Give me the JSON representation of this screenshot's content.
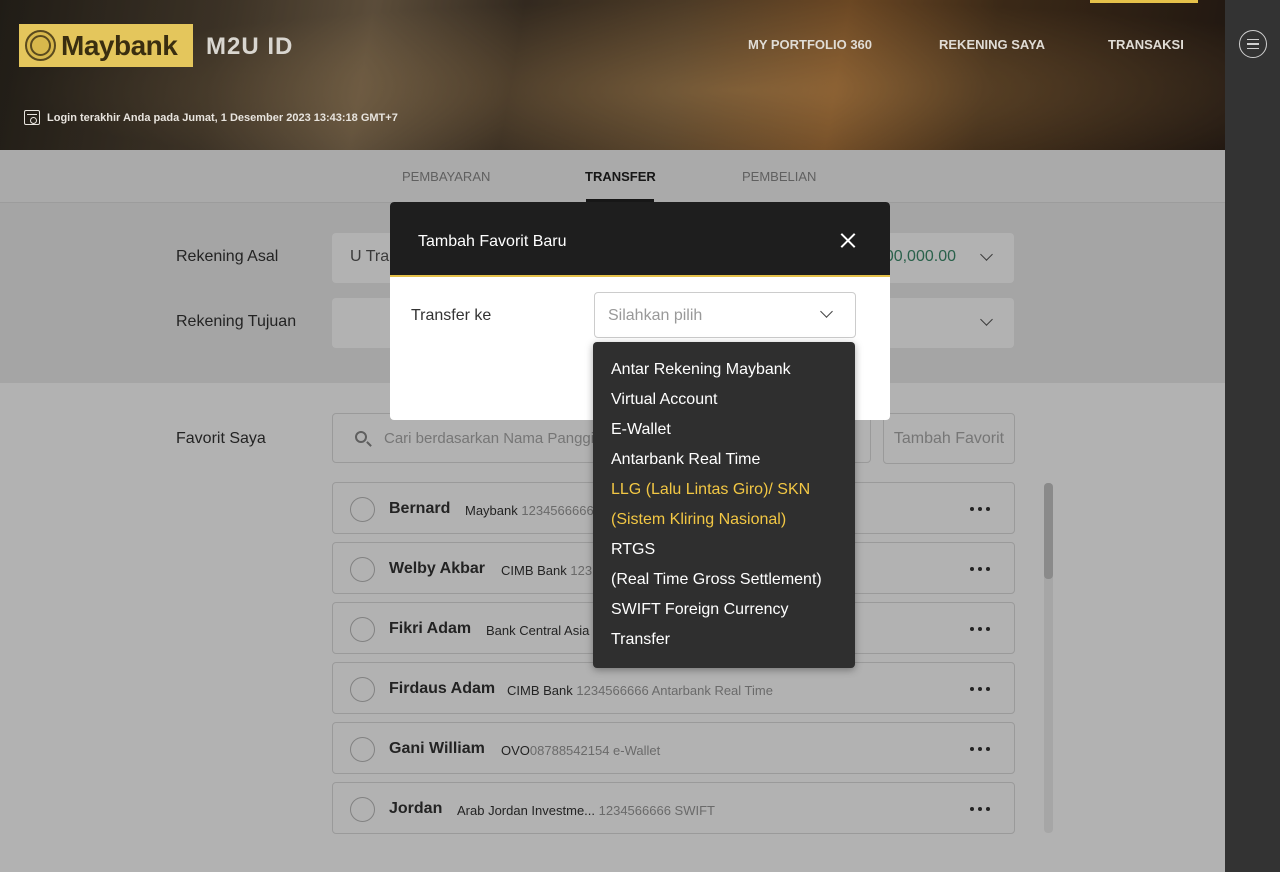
{
  "header": {
    "brand": "Maybank",
    "product": "M2U ID",
    "nav": [
      "MY PORTFOLIO 360",
      "REKENING SAYA",
      "TRANSAKSI"
    ],
    "last_login": "Login terakhir Anda pada Jumat, 1 Desember 2023 13:43:18 GMT+7"
  },
  "tabs": [
    "PEMBAYARAN",
    "TRANSFER",
    "PEMBELIAN"
  ],
  "active_tab": "TRANSFER",
  "form": {
    "source_label": "Rekening Asal",
    "source_value": "U Tra",
    "source_amount": "00,000.00",
    "dest_label": "Rekening Tujuan"
  },
  "favorites": {
    "label": "Favorit Saya",
    "search_placeholder": "Cari berdasarkan Nama Panggilan,",
    "add_button": "Tambah Favorit",
    "items": [
      {
        "name": "Bernard",
        "bank": "Maybank",
        "detail": "1234566666"
      },
      {
        "name": "Welby Akbar",
        "bank": "CIMB Bank",
        "detail": "123"
      },
      {
        "name": "Fikri Adam",
        "bank": "Bank Central Asia",
        "detail": ""
      },
      {
        "name": "Firdaus Adam",
        "bank": "CIMB Bank",
        "detail": "1234566666 Antarbank Real Time"
      },
      {
        "name": "Gani William",
        "bank": "OVO",
        "detail": "08788542154 e-Wallet"
      },
      {
        "name": "Jordan",
        "bank": "Arab Jordan Investme...",
        "detail": "1234566666 SWIFT"
      }
    ]
  },
  "modal": {
    "title": "Tambah Favorit Baru",
    "field_label": "Transfer ke",
    "select_placeholder": "Silahkan pilih"
  },
  "dropdown": {
    "options": [
      "Antar Rekening Maybank",
      "Virtual Account",
      "E-Wallet",
      "Antarbank Real Time",
      "LLG (Lalu Lintas Giro)/ SKN",
      "(Sistem Kliring Nasional)",
      "RTGS",
      "(Real Time Gross Settlement)",
      "SWIFT Foreign Currency",
      "Transfer"
    ],
    "highlighted_color": "#f2c744"
  },
  "colors": {
    "accent": "#e5c14a",
    "modal_header": "#1e1e1e",
    "amount": "#3d8b6c"
  }
}
